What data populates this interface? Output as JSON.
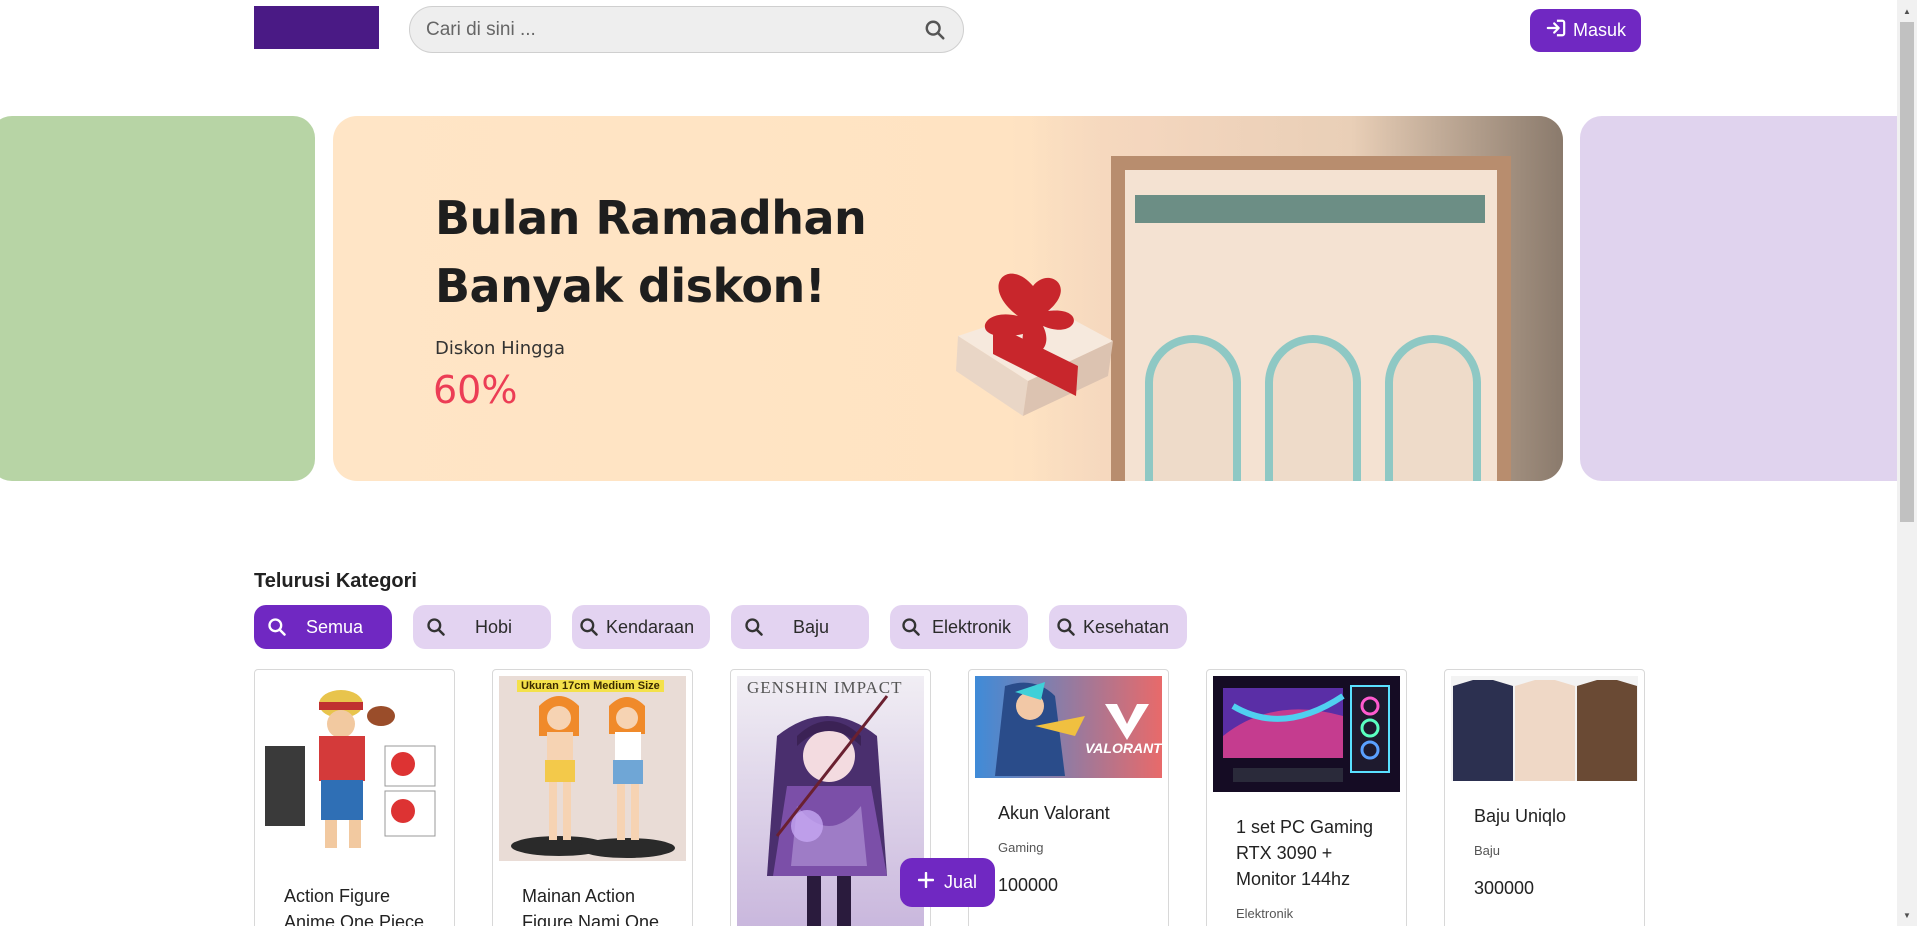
{
  "header": {
    "search_placeholder": "Cari di sini ...",
    "login_label": "Masuk"
  },
  "banner": {
    "title_line1": "Bulan Ramadhan",
    "title_line2": "Banyak diskon!",
    "subtitle": "Diskon Hingga",
    "percent": "60%"
  },
  "categories": {
    "title": "Telurusi Kategori",
    "items": [
      {
        "label": "Semua"
      },
      {
        "label": "Hobi"
      },
      {
        "label": "Kendaraan"
      },
      {
        "label": "Baju"
      },
      {
        "label": "Elektronik"
      },
      {
        "label": "Kesehatan"
      }
    ]
  },
  "products": [
    {
      "name": "Action Figure Anime One Piece",
      "category": "",
      "price": ""
    },
    {
      "name": "Mainan Action Figure Nami One",
      "category": "",
      "price": "",
      "image_caption": "Ukuran 17cm Medium Size"
    },
    {
      "name": "",
      "category": "",
      "price": "",
      "image_caption": "GENSHIN IMPACT"
    },
    {
      "name": "Akun Valorant",
      "category": "Gaming",
      "price": "100000",
      "image_caption": "VALORANT"
    },
    {
      "name": "1 set PC Gaming RTX 3090 + Monitor 144hz",
      "category": "Elektronik",
      "price": ""
    },
    {
      "name": "Baju Uniqlo",
      "category": "Baju",
      "price": "300000"
    }
  ],
  "sell_label": "Jual",
  "colors": {
    "primary": "#7028c2",
    "logo": "#4a1a85",
    "chip": "#e3d3f1",
    "banner_accent": "#ec3d55"
  }
}
